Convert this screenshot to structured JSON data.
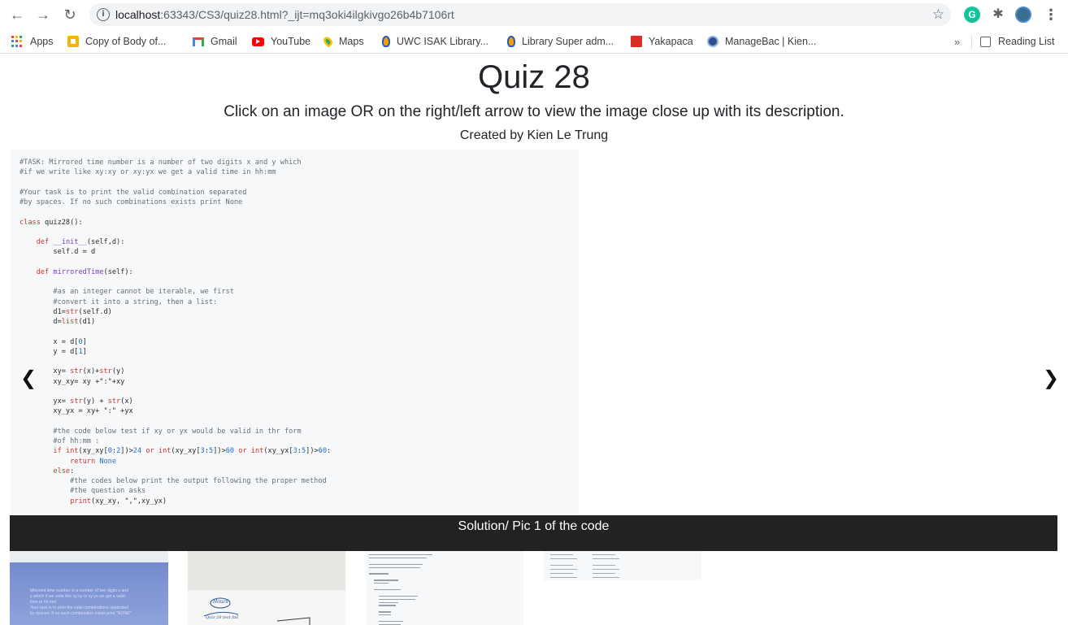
{
  "browser": {
    "url_host": "localhost",
    "url_path": ":63343/CS3/quiz28.html?_ijt=mq3oki4ilgkivgo26b4b7106rt",
    "nav_back_glyph": "←",
    "nav_forward_glyph": "→",
    "reload_glyph": "↻",
    "star_glyph": "☆",
    "grammarly_glyph": "G",
    "extensions_glyph": "✱",
    "menu_glyph": "⋮",
    "bookmarks": [
      {
        "label": "Apps",
        "icon": "apps-grid-icon"
      },
      {
        "label": "Copy of Body of...",
        "icon": "slides-icon",
        "color": "#f4b400"
      },
      {
        "label": "Gmail",
        "icon": "gmail-icon",
        "color": "#ea4335"
      },
      {
        "label": "YouTube",
        "icon": "youtube-icon",
        "color": "#ff0000"
      },
      {
        "label": "Maps",
        "icon": "maps-pin-icon",
        "color": "#34a853"
      },
      {
        "label": "UWC ISAK Library...",
        "icon": "library-icon",
        "color": "#1f5fbf"
      },
      {
        "label": "Library Super adm...",
        "icon": "library-icon",
        "color": "#1f5fbf"
      },
      {
        "label": "Yakapaca",
        "icon": "yakapaca-icon",
        "color": "#d93025"
      },
      {
        "label": "ManageBac | Kien...",
        "icon": "managebac-icon",
        "color": "#2b4f8f"
      }
    ],
    "more_label": "»",
    "reading_list_label": "Reading List"
  },
  "page": {
    "title": "Quiz 28",
    "subtitle": "Click on an image OR on the right/left arrow to view the image close up with its description.",
    "author": "Created by Kien Le Trung",
    "prev_glyph": "❮",
    "next_glyph": "❯",
    "caption": "Solution/ Pic 1 of the code"
  },
  "slide_code": [
    {
      "t": "cm",
      "s": "#TASK: Mirrored time number is a number of two digits x and y which"
    },
    {
      "t": "cm",
      "s": "#if we write like xy:xy or xy:yx we get a valid time in hh:mm"
    },
    {
      "t": "",
      "s": ""
    },
    {
      "t": "cm",
      "s": "#Your task is to print the valid combination separated"
    },
    {
      "t": "cm",
      "s": "#by spaces. If no such combinations exists print None"
    },
    {
      "t": "",
      "s": ""
    },
    {
      "t": "class",
      "s": "class quiz28():"
    },
    {
      "t": "",
      "s": ""
    },
    {
      "t": "def",
      "s": "    def __init__(self,d):"
    },
    {
      "t": "",
      "s": "        self.d = d"
    },
    {
      "t": "",
      "s": ""
    },
    {
      "t": "def",
      "s": "    def mirroredTime(self):"
    },
    {
      "t": "",
      "s": ""
    },
    {
      "t": "cm",
      "s": "        #as an integer cannot be iterable, we first"
    },
    {
      "t": "cm",
      "s": "        #convert it into a string, then a list:"
    },
    {
      "t": "",
      "s": "        d1=str(self.d)"
    },
    {
      "t": "",
      "s": "        d=list(d1)"
    },
    {
      "t": "",
      "s": ""
    },
    {
      "t": "",
      "s": "        x = d[0]"
    },
    {
      "t": "",
      "s": "        y = d[1]"
    },
    {
      "t": "",
      "s": ""
    },
    {
      "t": "",
      "s": "        xy= str(x)+str(y)"
    },
    {
      "t": "",
      "s": "        xy_xy= xy +\":\"+xy"
    },
    {
      "t": "",
      "s": ""
    },
    {
      "t": "",
      "s": "        yx= str(y) + str(x)"
    },
    {
      "t": "",
      "s": "        xy_yx = xy+ \":\" +yx"
    },
    {
      "t": "",
      "s": ""
    },
    {
      "t": "cm",
      "s": "        #the code below test if xy or yx would be valid in thr form"
    },
    {
      "t": "cm",
      "s": "        #of hh:mm :"
    },
    {
      "t": "",
      "s": "        if int(xy_xy[0:2])>24 or int(xy_xy[3:5])>60 or int(xy_yx[3:5])>60:"
    },
    {
      "t": "kw",
      "s": "            return None"
    },
    {
      "t": "kw",
      "s": "        else:"
    },
    {
      "t": "cm",
      "s": "            #the codes below print the output following the proper method"
    },
    {
      "t": "cm",
      "s": "            #the question asks"
    },
    {
      "t": "",
      "s": "            print(xy_xy, \",\",xy_yx)"
    }
  ],
  "thumbnails": [
    {
      "label": "thumbnail-whiteboard-task"
    },
    {
      "label": "thumbnail-handwritten-notes"
    },
    {
      "label": "thumbnail-code-solution"
    },
    {
      "label": "thumbnail-code-output"
    }
  ],
  "thumb1_text": [
    "Mirrored time number is a number of two digits x and",
    "y which if we write like xy:xy or xy:yx we get a valid",
    "time in hh:mm",
    "Your task is to print the valid combinations separated",
    "by spaces. If no such combination exists print \"NONE\""
  ],
  "thumb2_text": [
    "Hours",
    "Quiz 28 test fail"
  ]
}
